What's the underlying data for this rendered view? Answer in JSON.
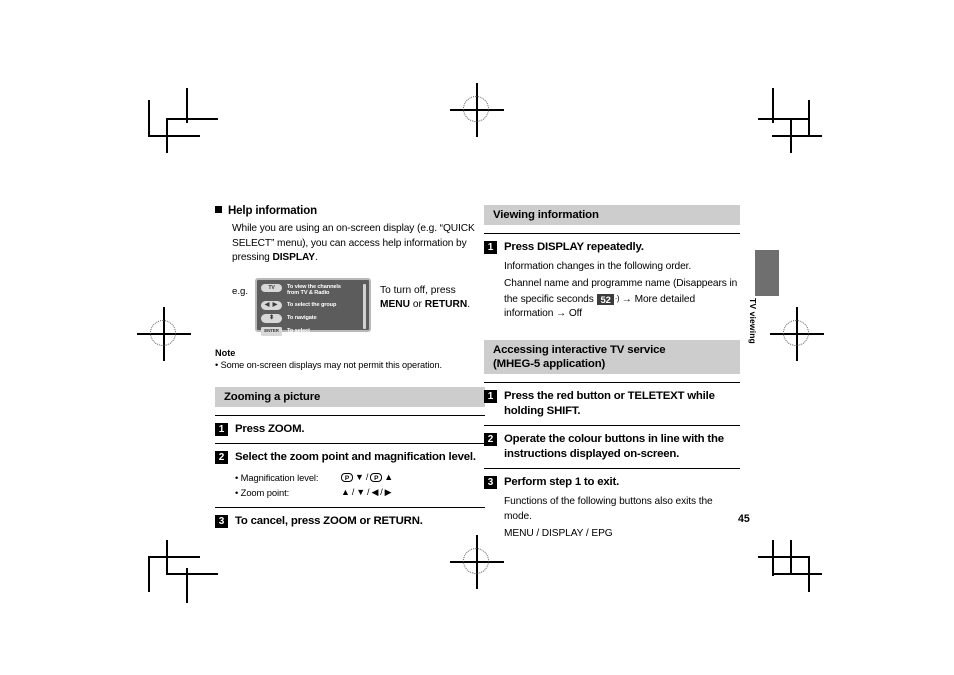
{
  "document": {
    "page_number": "45",
    "side_tab": "TV viewing"
  },
  "left_column": {
    "help_section": {
      "heading": "Help information",
      "body_1": "While you are using an on-screen display (e.g. “QUICK SELECT” menu), you can access help information by pressing ",
      "body_1_bold": "DISPLAY",
      "body_1_end": ".",
      "example_label": "e.g.",
      "osd_rows": [
        {
          "key": "TV",
          "key_type": "tv",
          "text_line_1": "To view the channels",
          "text_line_2": "from TV & Radio"
        },
        {
          "key": "◀ ▶",
          "key_type": "lr",
          "text_line_1": "To select the group",
          "text_line_2": ""
        },
        {
          "key": "⬍",
          "key_type": "nav",
          "text_line_1": "To navigate",
          "text_line_2": ""
        },
        {
          "key": "ENTER",
          "key_type": "enter",
          "text_line_1": "To select",
          "text_line_2": ""
        }
      ],
      "turn_off_line_1": "To turn off, press",
      "turn_off_bold_1": "MENU",
      "turn_off_mid": " or ",
      "turn_off_bold_2": "RETURN",
      "turn_off_end": "."
    },
    "note": {
      "heading": "Note",
      "item": "• Some on-screen displays may not permit this operation."
    },
    "zoom_section": {
      "header": "Zooming a picture",
      "steps": [
        {
          "number": "1",
          "title": "Press ZOOM."
        },
        {
          "number": "2",
          "title": "Select the zoom point and magnification level."
        },
        {
          "number": "3",
          "title": "To cancel, press ZOOM or RETURN."
        }
      ],
      "bullets": [
        {
          "label": "• Magnification level:",
          "symbols": "P ▼ / P ▲"
        },
        {
          "label": "• Zoom point:",
          "symbols": "▲ / ▼ / ◀ / ▶"
        }
      ],
      "pkey_label": "P"
    }
  },
  "right_column": {
    "viewing_information": {
      "header": "Viewing information",
      "step_number": "1",
      "step_title": "Press DISPLAY repeatedly.",
      "sub_1": "Information changes in the following order.",
      "sub_2_part_1": "Channel name and programme name (Disappears in the specific seconds ",
      "page_ref": "52",
      "page_ref_mark": "·)",
      "sub_2_part_2": " → More detailed information → Off"
    },
    "interactive_section": {
      "header_line_1": "Accessing interactive TV service",
      "header_line_2": "(MHEG-5 application)",
      "steps": [
        {
          "number": "1",
          "title": "Press the red button or TELETEXT while holding SHIFT."
        },
        {
          "number": "2",
          "title": "Operate the colour buttons in line with the instructions displayed on-screen."
        },
        {
          "number": "3",
          "title": "Perform step 1 to exit."
        }
      ],
      "step3_sub_1": "Functions of the following buttons also exits the mode.",
      "step3_sub_2": "MENU / DISPLAY / EPG"
    }
  }
}
